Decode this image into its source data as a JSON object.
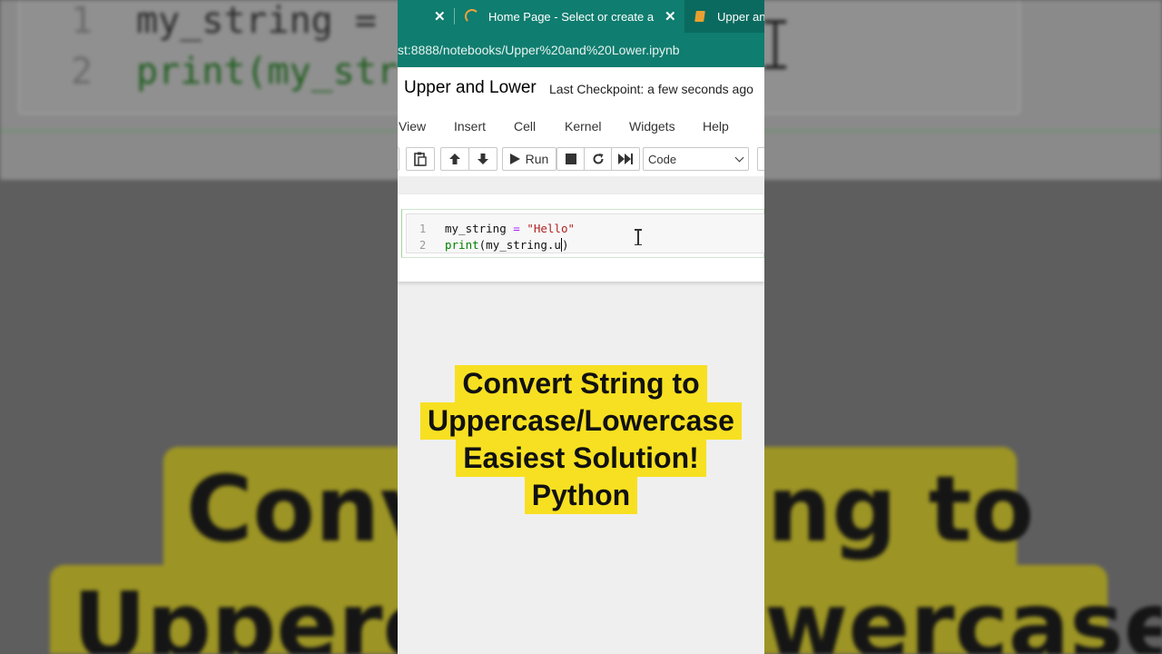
{
  "background": {
    "code_lines": [
      {
        "number": "1",
        "text": "my_string ="
      },
      {
        "number": "2",
        "text": "print(my_str"
      }
    ],
    "caption_lines": [
      "Conv",
      "ng to",
      "Upperc",
      "wercase"
    ]
  },
  "browser": {
    "tabs": [
      {
        "label": "Home Page - Select or create a n"
      },
      {
        "label": "Upper an"
      }
    ],
    "close_glyph": "✕",
    "url": "st:8888/notebooks/Upper%20and%20Lower.ipynb"
  },
  "notebook": {
    "title": "Upper and Lower",
    "checkpoint": "Last Checkpoint: a few seconds ago",
    "trailing": "(",
    "menu": [
      "View",
      "Insert",
      "Cell",
      "Kernel",
      "Widgets",
      "Help"
    ],
    "toolbar": {
      "run_label": "Run",
      "cell_type": "Code"
    },
    "cell": {
      "lines": [
        {
          "number": "1",
          "var": "my_string",
          "op": " = ",
          "str": "\"Hello\""
        },
        {
          "number": "2",
          "func": "print",
          "arg": "(my_string.u",
          "close": ")"
        }
      ]
    }
  },
  "caption": {
    "lines": [
      "Convert String to",
      "Uppercase/Lowercase",
      "Easiest Solution!",
      "Python"
    ]
  },
  "colors": {
    "tab_bg": "#0f7d6f",
    "caption_highlight": "#f7e021",
    "code_string": "#b22222",
    "code_keyword": "#008000",
    "code_operator": "#aa22ff"
  }
}
